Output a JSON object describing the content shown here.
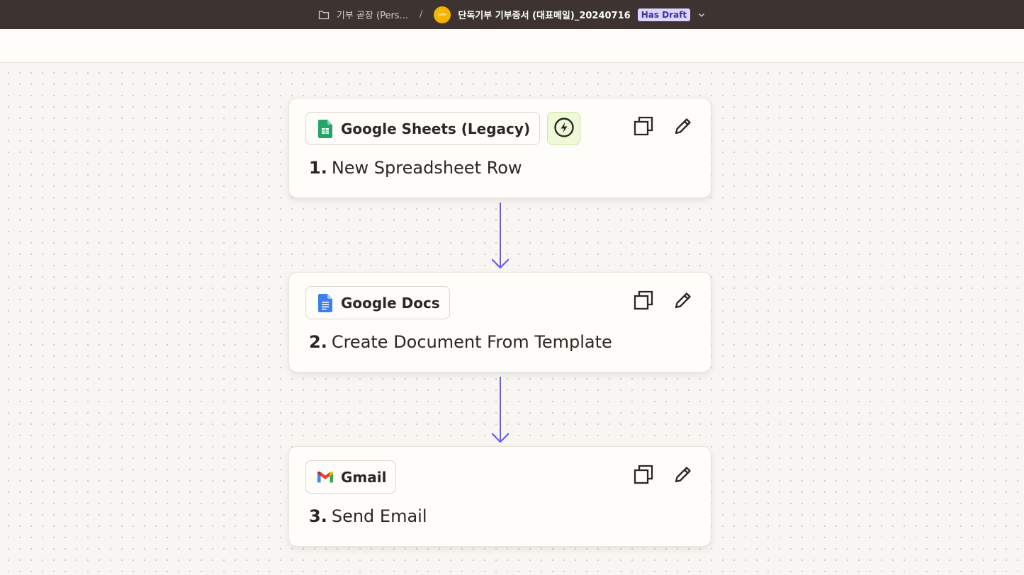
{
  "header": {
    "folder_label": "기부 곧장 (Pers...",
    "separator": "/",
    "zap_title": "단독기부 기부증서 (대표메일)_20240716",
    "draft_badge": "Has Draft"
  },
  "colors": {
    "topbar": "#3d3431",
    "connector": "#6a5ce6",
    "trigger_bg": "#eef9d8"
  },
  "steps": [
    {
      "number": "1.",
      "app": "Google Sheets (Legacy)",
      "action": "New Spreadsheet Row",
      "icon": "google-sheets-icon",
      "trigger": true
    },
    {
      "number": "2.",
      "app": "Google Docs",
      "action": "Create Document From Template",
      "icon": "google-docs-icon",
      "trigger": false
    },
    {
      "number": "3.",
      "app": "Gmail",
      "action": "Send Email",
      "icon": "gmail-icon",
      "trigger": false
    }
  ]
}
